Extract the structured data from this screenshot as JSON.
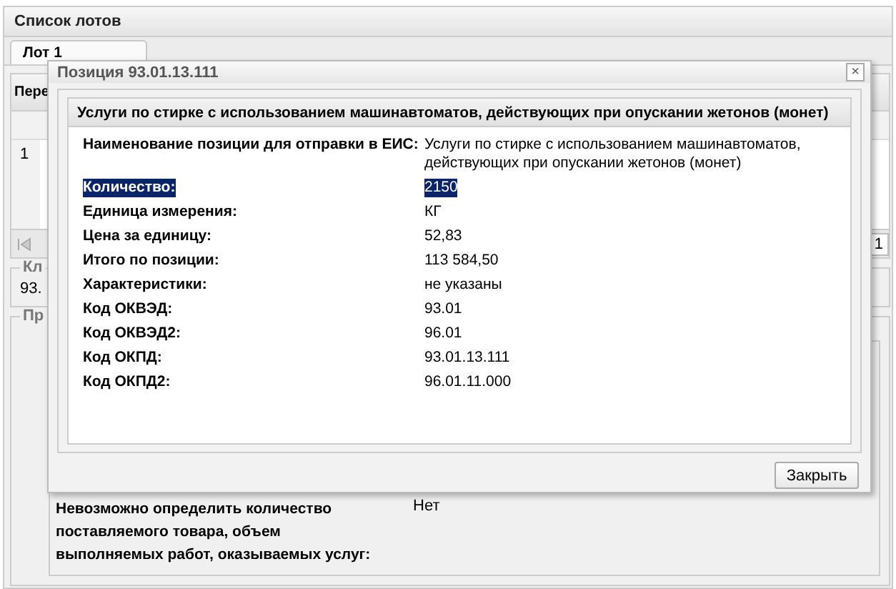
{
  "page": {
    "title": "Список лотов",
    "tabs": [
      {
        "label": "Лот 1",
        "selected": true
      }
    ],
    "grid": {
      "header": "Пере",
      "row_number": "1",
      "pager_page": "1"
    },
    "fieldset_1": {
      "legend": "Кл",
      "value": "93."
    },
    "fieldset_2": {
      "legend": "Пр",
      "rows": [
        {
          "label": "Невозможно определить количество поставляемого товара, объем выполняемых работ, оказываемых услуг:",
          "value": "Нет"
        }
      ]
    }
  },
  "dialog": {
    "title": "Позиция 93.01.13.111",
    "close": "×",
    "panel_title": "Услуги по стирке с использованием машинавтоматов, действующих при опускании жетонов (монет)",
    "rows": [
      {
        "label": "Наименование позиции для отправки в ЕИС:",
        "value": "Услуги по стирке с использованием машинавтоматов, действующих при опускании жетонов (монет)",
        "selected": false
      },
      {
        "label": "Количество:",
        "value": "2150",
        "selected": true
      },
      {
        "label": "Единица измерения:",
        "value": "КГ",
        "selected": false
      },
      {
        "label": "Цена за единицу:",
        "value": "52,83",
        "selected": false
      },
      {
        "label": "Итого по позиции:",
        "value": "113 584,50",
        "selected": false
      },
      {
        "label": "Характеристики:",
        "value": "не указаны",
        "selected": false
      },
      {
        "label": "Код ОКВЭД:",
        "value": "93.01",
        "selected": false
      },
      {
        "label": "Код ОКВЭД2:",
        "value": "96.01",
        "selected": false
      },
      {
        "label": "Код ОКПД:",
        "value": "93.01.13.111",
        "selected": false
      },
      {
        "label": "Код ОКПД2:",
        "value": "96.01.11.000",
        "selected": false
      }
    ],
    "buttons": [
      "Закрыть"
    ]
  }
}
